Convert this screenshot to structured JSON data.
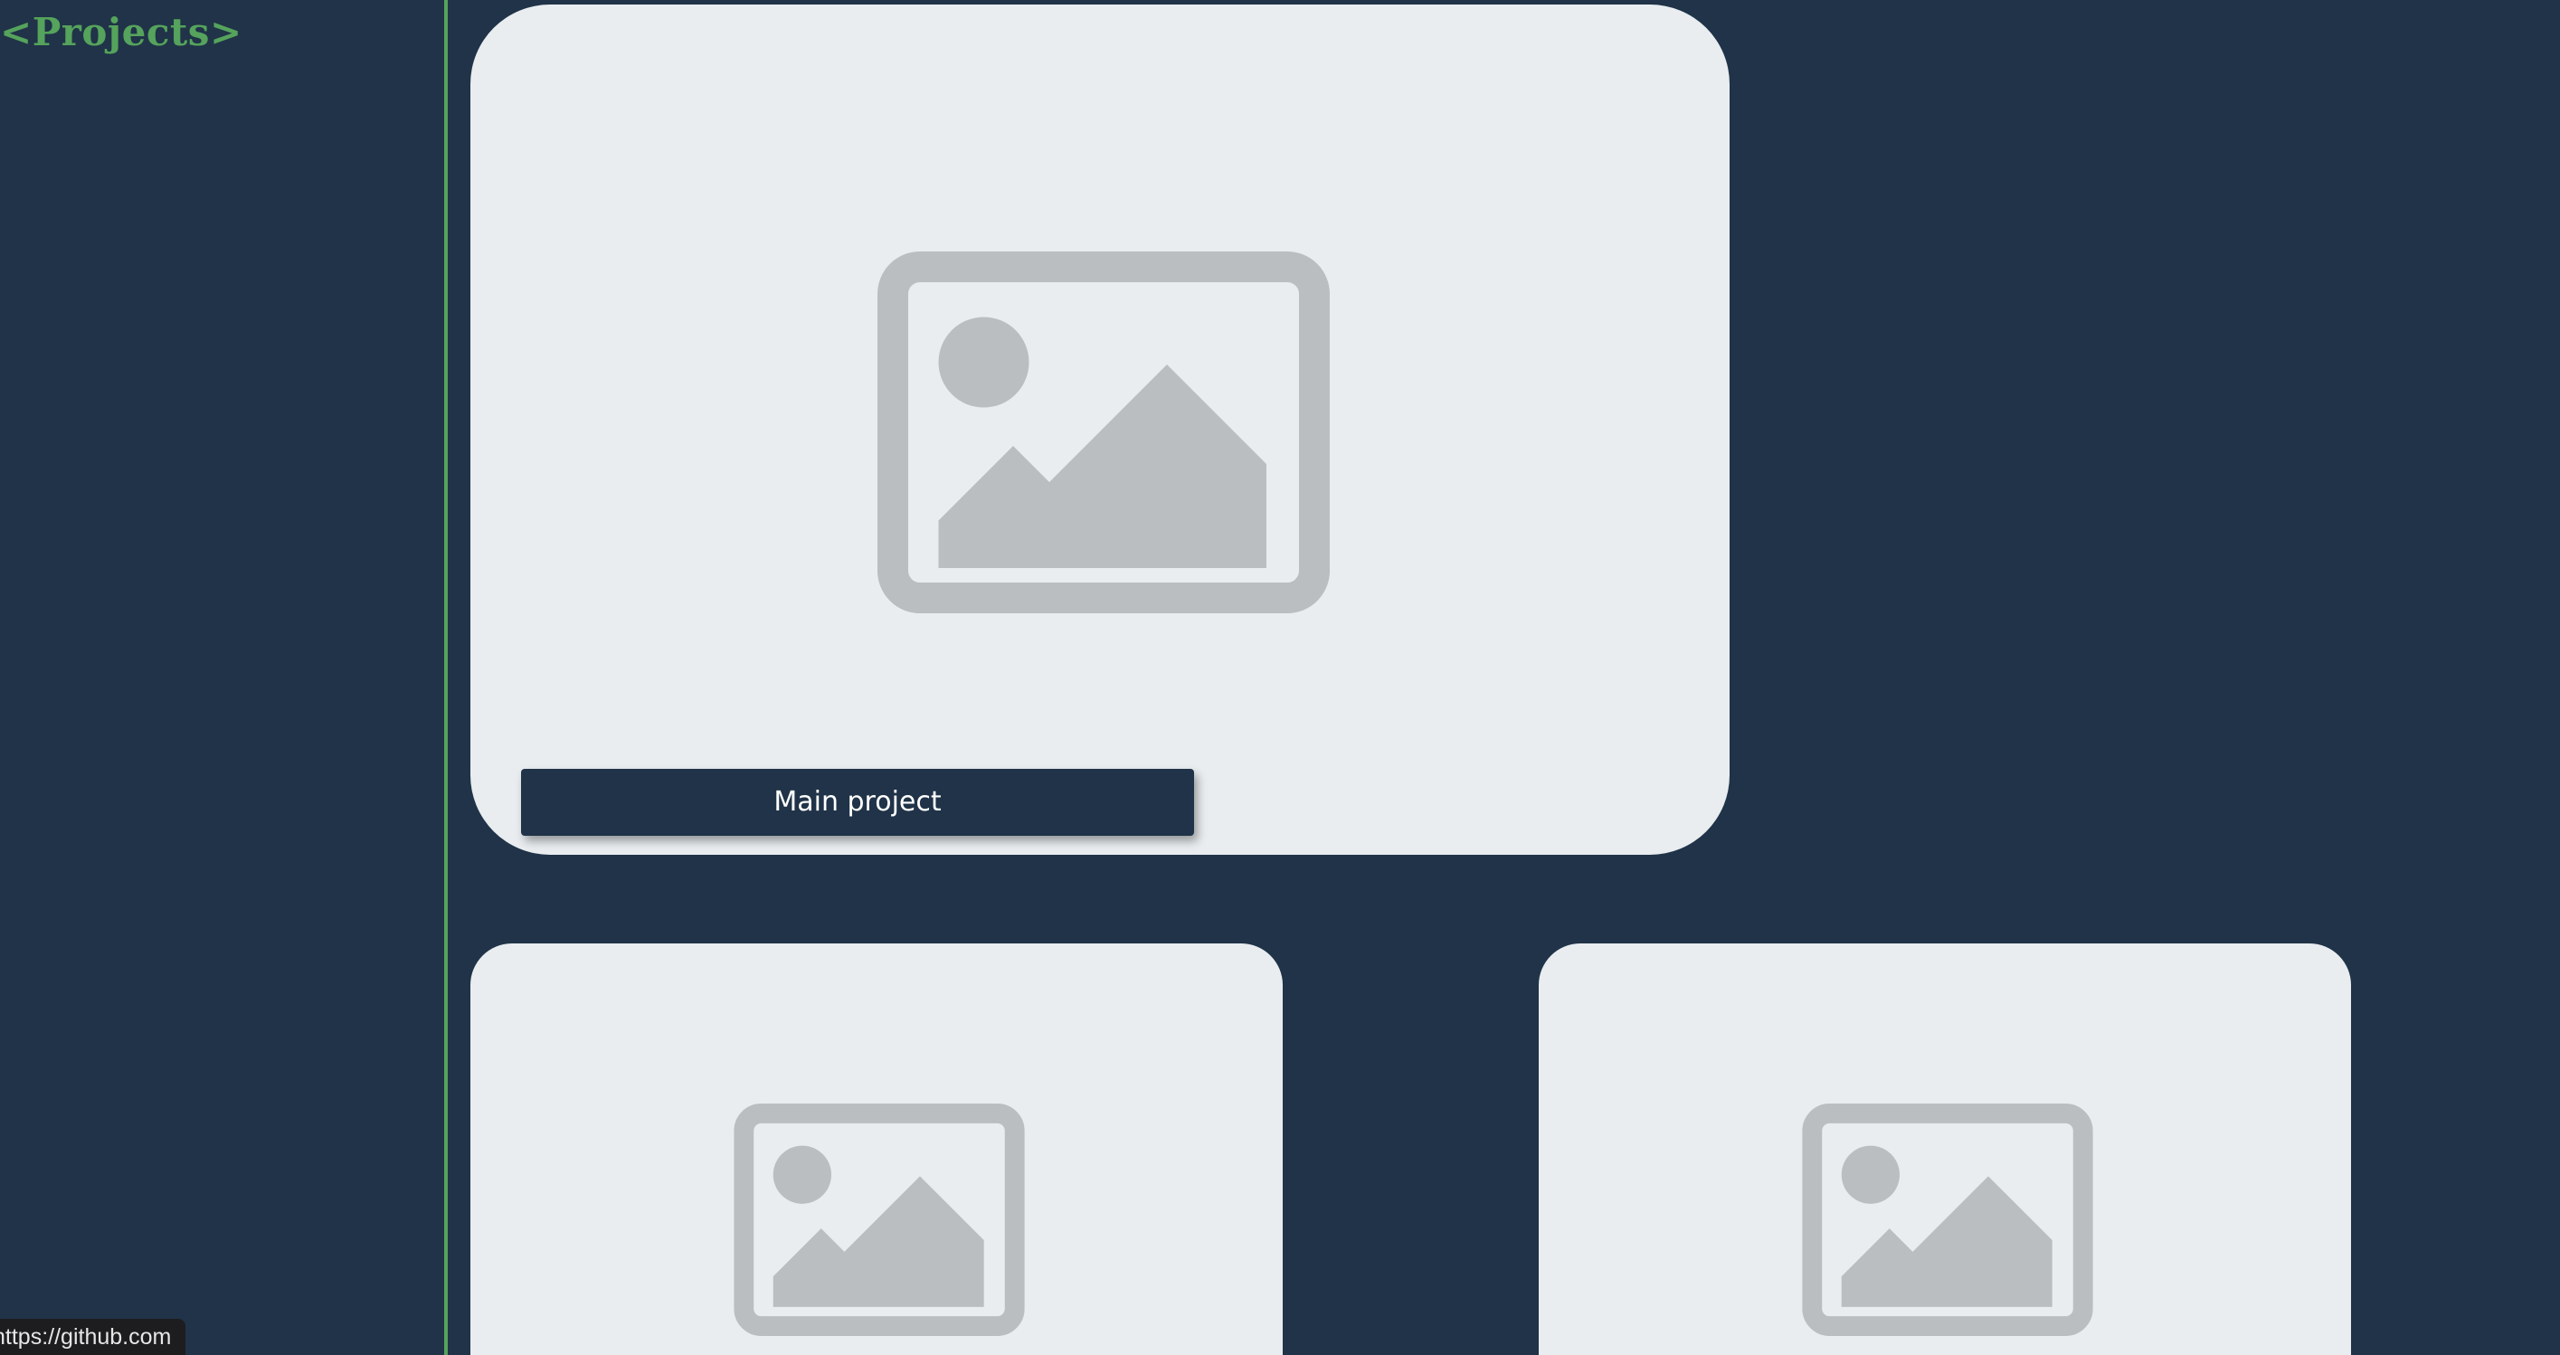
{
  "sidebar": {
    "title": "<Projects>"
  },
  "projects": {
    "main": {
      "button_label": "Main project",
      "image_icon": "image-placeholder-icon"
    },
    "secondary": [
      {
        "image_icon": "image-placeholder-icon"
      },
      {
        "image_icon": "image-placeholder-icon"
      }
    ]
  },
  "status_bar": {
    "url": "https://github.com"
  },
  "colors": {
    "background": "#203348",
    "accent": "#55a35c",
    "card": "#e9edf0",
    "placeholder": "#babec1",
    "button_text": "#ffffff"
  }
}
